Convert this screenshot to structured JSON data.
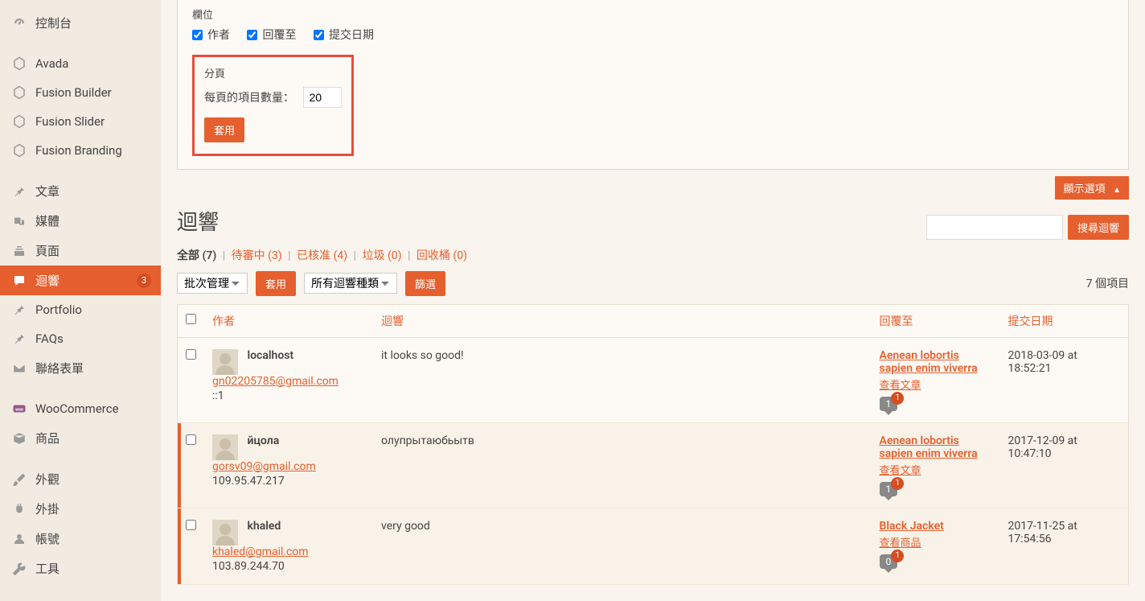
{
  "sidebar": {
    "items": [
      {
        "label": "控制台"
      },
      {
        "label": "Avada"
      },
      {
        "label": "Fusion Builder"
      },
      {
        "label": "Fusion Slider"
      },
      {
        "label": "Fusion Branding"
      },
      {
        "label": "文章"
      },
      {
        "label": "媒體"
      },
      {
        "label": "頁面"
      },
      {
        "label": "迴響",
        "badge": "3",
        "active": true
      },
      {
        "label": "Portfolio"
      },
      {
        "label": "FAQs"
      },
      {
        "label": "聯絡表單"
      },
      {
        "label": "WooCommerce"
      },
      {
        "label": "商品"
      },
      {
        "label": "外觀"
      },
      {
        "label": "外掛"
      },
      {
        "label": "帳號"
      },
      {
        "label": "工具"
      }
    ]
  },
  "screen_options": {
    "columns_title": "欄位",
    "cb_author": "作者",
    "cb_reply": "回覆至",
    "cb_date": "提交日期",
    "pagination_title": "分頁",
    "per_page_label": "每頁的項目數量：",
    "per_page_value": "20",
    "apply_label": "套用",
    "toggle_label": "顯示選項"
  },
  "page": {
    "title": "迴響",
    "search_button": "搜尋迴響"
  },
  "subsub": {
    "all": "全部",
    "all_count": "(7)",
    "pending": "待審中",
    "pending_count": "(3)",
    "approved": "已核准",
    "approved_count": "(4)",
    "trash": "垃圾",
    "trash_count": "(0)",
    "bin": "回收桶",
    "bin_count": "(0)"
  },
  "tablenav": {
    "bulk": "批次管理",
    "apply": "套用",
    "filter_type": "所有迴響種類",
    "filter": "篩選",
    "count": "7 個項目"
  },
  "columns": {
    "author": "作者",
    "comment": "迴響",
    "reply_to": "回覆至",
    "date": "提交日期"
  },
  "rows": [
    {
      "author_name": "localhost",
      "author_email": "gn02205785@gmail.com",
      "author_ip": "::1",
      "comment": "it looks so good!",
      "reply_title": "Aenean lobortis sapien enim viverra",
      "reply_view": "查看文章",
      "bubble": "1",
      "bubble_badge": "1",
      "date": "2018-03-09 at 18:52:21",
      "pending": false
    },
    {
      "author_name": "йцола",
      "author_email": "gorsv09@gmail.com",
      "author_ip": "109.95.47.217",
      "comment": "олупрытаюбьытв",
      "reply_title": "Aenean lobortis sapien enim viverra",
      "reply_view": "查看文章",
      "bubble": "1",
      "bubble_badge": "1",
      "date": "2017-12-09 at 10:47:10",
      "pending": true
    },
    {
      "author_name": "khaled",
      "author_email": "khaled@gmail.com",
      "author_ip": "103.89.244.70",
      "comment": "very good",
      "reply_title": "Black Jacket",
      "reply_view": "查看商品",
      "bubble": "0",
      "bubble_badge": "1",
      "date": "2017-11-25 at 17:54:56",
      "pending": true
    }
  ]
}
